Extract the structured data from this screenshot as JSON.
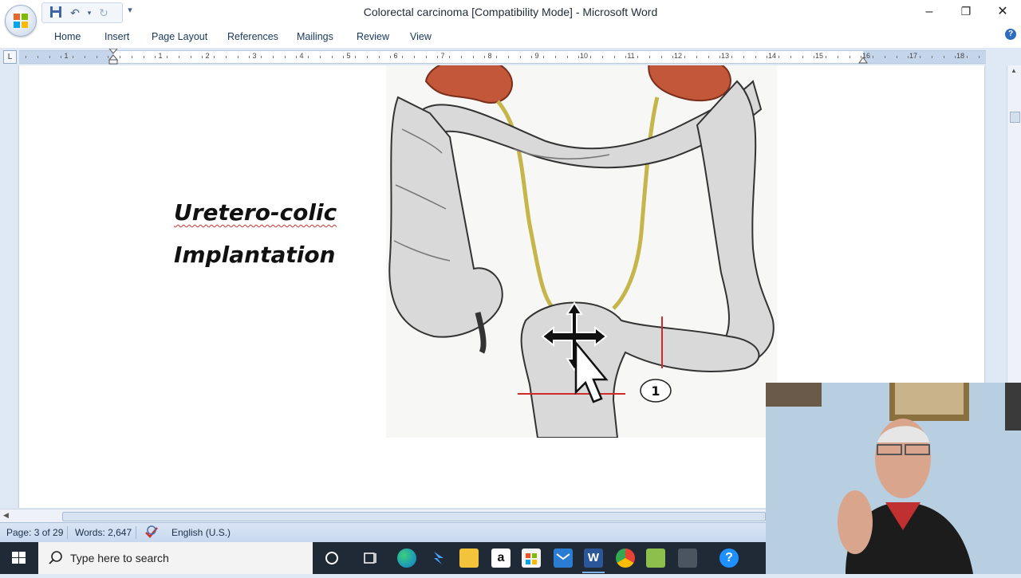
{
  "window": {
    "title": "Colorectal carcinoma [Compatibility Mode] - Microsoft Word",
    "controls": {
      "minimize": "–",
      "restore": "❐",
      "close": "✕"
    }
  },
  "ribbon": {
    "tabs": [
      "Home",
      "Insert",
      "Page Layout",
      "References",
      "Mailings",
      "Review",
      "View"
    ]
  },
  "ruler": {
    "numbers": [
      "1",
      "1",
      "2",
      "3",
      "4",
      "5",
      "6",
      "7",
      "8",
      "9",
      "10",
      "11",
      "12",
      "13",
      "14",
      "15",
      "16",
      "17",
      "18"
    ]
  },
  "document": {
    "title_line1": "Uretero-colic",
    "title_line2": "Implantation",
    "figure_label": "1"
  },
  "status": {
    "page": "Page: 3 of 29",
    "words": "Words: 2,647",
    "language": "English (U.S.)"
  },
  "taskbar": {
    "search_placeholder": "Type here to search",
    "icons": [
      "cortana-icon",
      "task-view-icon",
      "edge-icon",
      "app-icon",
      "file-explorer-icon",
      "amazon-icon",
      "store-icon",
      "mail-icon",
      "word-icon",
      "chrome-icon",
      "app-green-icon",
      "app-dark-icon",
      "help-icon"
    ]
  },
  "colors": {
    "accent": "#2f6cc0",
    "ribbon_text": "#17375e",
    "taskbar": "#1f2a36",
    "spell_underline": "#d13030"
  }
}
